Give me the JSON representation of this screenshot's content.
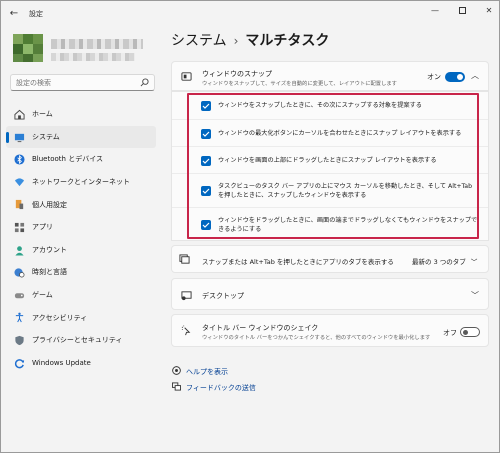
{
  "window": {
    "title": "設定"
  },
  "search": {
    "placeholder": "設定の検索"
  },
  "nav": {
    "items": [
      {
        "label": "ホーム",
        "icon": "home-icon"
      },
      {
        "label": "システム",
        "icon": "system-icon",
        "active": true
      },
      {
        "label": "Bluetooth とデバイス",
        "icon": "bluetooth-icon"
      },
      {
        "label": "ネットワークとインターネット",
        "icon": "network-icon"
      },
      {
        "label": "個人用設定",
        "icon": "personalization-icon"
      },
      {
        "label": "アプリ",
        "icon": "apps-icon"
      },
      {
        "label": "アカウント",
        "icon": "accounts-icon"
      },
      {
        "label": "時刻と言語",
        "icon": "time-language-icon"
      },
      {
        "label": "ゲーム",
        "icon": "gaming-icon"
      },
      {
        "label": "アクセシビリティ",
        "icon": "accessibility-icon"
      },
      {
        "label": "プライバシーとセキュリティ",
        "icon": "privacy-icon"
      },
      {
        "label": "Windows Update",
        "icon": "windows-update-icon"
      }
    ]
  },
  "breadcrumb": {
    "parent": "システム",
    "separator": "›",
    "current": "マルチタスク"
  },
  "snap": {
    "title": "ウィンドウのスナップ",
    "description": "ウィンドウをスナップして、サイズを自動的に変更して、レイアウトに配置します",
    "state_label": "オン",
    "options": [
      "ウィンドウをスナップしたときに、その次にスナップする対象を提案する",
      "ウィンドウの最大化ボタンにカーソルを合わせたときにスナップ レイアウトを表示する",
      "ウィンドウを画面の上部にドラッグしたときにスナップ レイアウトを表示する",
      "タスクビューのタスク バー アプリの上にマウス カーソルを移動したとき、そして Alt+Tab を押したときに、スナップしたウィンドウを表示する",
      "ウィンドウをドラッグしたときに、画面の端までドラッグしなくてもウィンドウをスナップできるようにする"
    ]
  },
  "alttab": {
    "title": "スナップまたは Alt+Tab を押したときにアプリのタブを表示する",
    "value": "最新の 3 つのタブ"
  },
  "desktops": {
    "title": "デスクトップ"
  },
  "shake": {
    "title": "タイトル バー ウィンドウのシェイク",
    "description": "ウィンドウのタイトル バーをつかんでシェイクすると、他のすべてのウィンドウを最小化します",
    "state_label": "オフ"
  },
  "links": {
    "help": "ヘルプを表示",
    "feedback": "フィードバックの送信"
  },
  "colors": {
    "accent": "#0067c0",
    "highlight": "#c8254a"
  }
}
